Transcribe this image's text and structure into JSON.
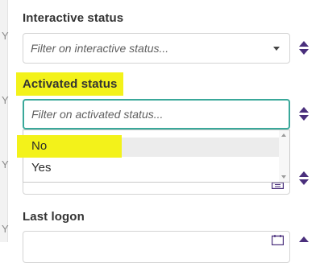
{
  "filters": {
    "interactive_status": {
      "label": "Interactive status",
      "placeholder": "Filter on interactive status..."
    },
    "activated_status": {
      "label": "Activated status",
      "placeholder": "Filter on activated status...",
      "options": [
        "No",
        "Yes"
      ],
      "highlighted_option": "No"
    },
    "last_logon": {
      "label": "Last logon"
    }
  },
  "icons": {
    "sort": "sort-up-down-icon",
    "dropdown": "chevron-down-icon",
    "calendar": "calendar-icon"
  },
  "colors": {
    "highlight": "#f3f21a",
    "focus_border": "#3aa89a",
    "sort_icon": "#4a2f7c"
  }
}
